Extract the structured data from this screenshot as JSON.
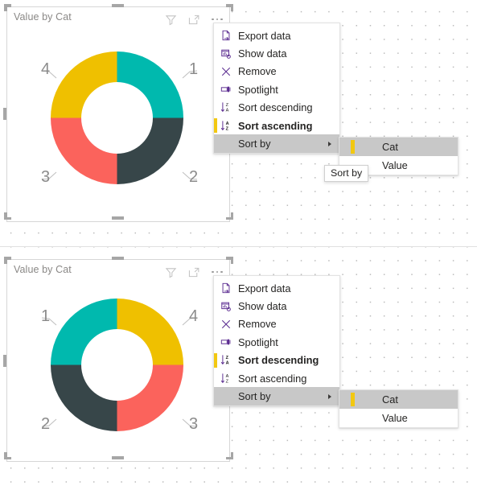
{
  "canvas": {
    "background": "#ffffff",
    "grid_dot_color": "#b9b9b9"
  },
  "palette": {
    "teal": "#00B9AE",
    "dark_slate": "#374649",
    "red": "#FB635C",
    "yellow": "#EFC000",
    "accent_yellow": "#F2C811",
    "icon_purple": "#5C2D91",
    "menu_highlight": "#C8C8C8",
    "title_gray": "#8A8886",
    "label_gray": "#8B8B8B"
  },
  "visuals": [
    {
      "id": "visual-top",
      "title": "Value by Cat",
      "header_icons": [
        {
          "name": "filter-icon",
          "label": "Filters"
        },
        {
          "name": "focus-mode-icon",
          "label": "Focus mode"
        },
        {
          "name": "more-options-icon",
          "label": "More options"
        }
      ],
      "chart_data": {
        "type": "pie",
        "title": "Value by Cat",
        "sort_order": "ascending",
        "sorted_by": "Cat",
        "categories": [
          "1",
          "2",
          "3",
          "4"
        ],
        "values": [
          25,
          25,
          25,
          25
        ],
        "labels": [
          "1",
          "2",
          "3",
          "4"
        ],
        "colors": [
          "#00B9AE",
          "#374649",
          "#FB635C",
          "#EFC000"
        ],
        "legend": "none",
        "donut": true,
        "inner_radius_ratio": 0.53,
        "start_angle_deg": 0,
        "slice_order_clockwise": [
          "1",
          "2",
          "3",
          "4"
        ]
      },
      "menu": {
        "items": [
          {
            "label": "Export data",
            "icon": "export-data-icon",
            "bold": false,
            "selected": false,
            "highlight": false,
            "submenu": false
          },
          {
            "label": "Show data",
            "icon": "show-data-icon",
            "bold": false,
            "selected": false,
            "highlight": false,
            "submenu": false
          },
          {
            "label": "Remove",
            "icon": "remove-icon",
            "bold": false,
            "selected": false,
            "highlight": false,
            "submenu": false
          },
          {
            "label": "Spotlight",
            "icon": "spotlight-icon",
            "bold": false,
            "selected": false,
            "highlight": false,
            "submenu": false
          },
          {
            "label": "Sort descending",
            "icon": "sort-descending-icon",
            "bold": false,
            "selected": false,
            "highlight": false,
            "submenu": false
          },
          {
            "label": "Sort ascending",
            "icon": "sort-ascending-icon",
            "bold": true,
            "selected": true,
            "highlight": false,
            "submenu": false
          },
          {
            "label": "Sort by",
            "icon": "none",
            "bold": false,
            "selected": false,
            "highlight": true,
            "submenu": true
          }
        ],
        "submenu": {
          "items": [
            {
              "label": "Cat",
              "selected": true,
              "highlight": true
            },
            {
              "label": "Value",
              "selected": false,
              "highlight": false
            }
          ]
        },
        "tooltip": {
          "text": "Sort by"
        }
      }
    },
    {
      "id": "visual-bottom",
      "title": "Value by Cat",
      "header_icons": [
        {
          "name": "filter-icon",
          "label": "Filters"
        },
        {
          "name": "focus-mode-icon",
          "label": "Focus mode"
        },
        {
          "name": "more-options-icon",
          "label": "More options"
        }
      ],
      "chart_data": {
        "type": "pie",
        "title": "Value by Cat",
        "sort_order": "descending",
        "sorted_by": "Cat",
        "categories": [
          "4",
          "3",
          "2",
          "1"
        ],
        "values": [
          25,
          25,
          25,
          25
        ],
        "labels": [
          "4",
          "3",
          "2",
          "1"
        ],
        "colors": [
          "#EFC000",
          "#FB635C",
          "#374649",
          "#00B9AE"
        ],
        "legend": "none",
        "donut": true,
        "inner_radius_ratio": 0.53,
        "start_angle_deg": 0,
        "slice_order_clockwise": [
          "4",
          "3",
          "2",
          "1"
        ]
      },
      "menu": {
        "items": [
          {
            "label": "Export data",
            "icon": "export-data-icon",
            "bold": false,
            "selected": false,
            "highlight": false,
            "submenu": false
          },
          {
            "label": "Show data",
            "icon": "show-data-icon",
            "bold": false,
            "selected": false,
            "highlight": false,
            "submenu": false
          },
          {
            "label": "Remove",
            "icon": "remove-icon",
            "bold": false,
            "selected": false,
            "highlight": false,
            "submenu": false
          },
          {
            "label": "Spotlight",
            "icon": "spotlight-icon",
            "bold": false,
            "selected": false,
            "highlight": false,
            "submenu": false
          },
          {
            "label": "Sort descending",
            "icon": "sort-descending-icon",
            "bold": true,
            "selected": true,
            "highlight": false,
            "submenu": false
          },
          {
            "label": "Sort ascending",
            "icon": "sort-ascending-icon",
            "bold": false,
            "selected": false,
            "highlight": false,
            "submenu": false
          },
          {
            "label": "Sort by",
            "icon": "none",
            "bold": false,
            "selected": false,
            "highlight": true,
            "submenu": true
          }
        ],
        "submenu": {
          "items": [
            {
              "label": "Cat",
              "selected": true,
              "highlight": true
            },
            {
              "label": "Value",
              "selected": false,
              "highlight": false
            }
          ]
        },
        "tooltip": null
      }
    }
  ]
}
